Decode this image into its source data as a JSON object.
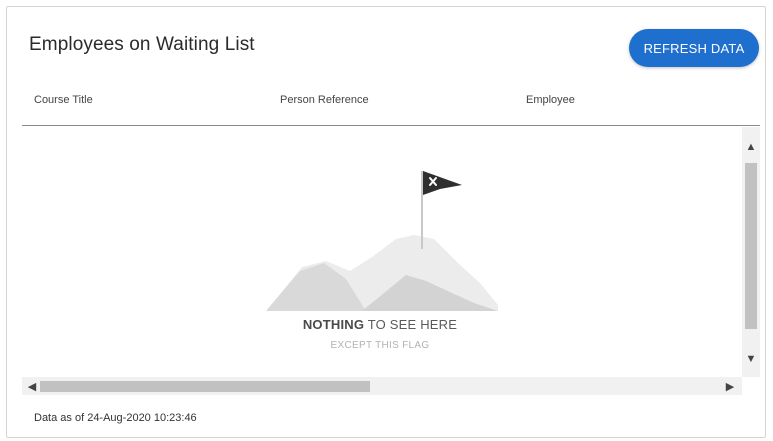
{
  "panel": {
    "title": "Employees on Waiting List",
    "refresh_label": "REFRESH DATA"
  },
  "table": {
    "columns": [
      "Course Title",
      "Person Reference",
      "Employee"
    ]
  },
  "empty_state": {
    "title_bold": "NOTHING",
    "title_rest": " TO SEE HERE",
    "subtitle": "EXCEPT THIS FLAG",
    "icon": "flag-on-mountain-icon"
  },
  "footer": {
    "timestamp_text": "Data as of 24-Aug-2020 10:23:46"
  },
  "colors": {
    "accent": "#1e6fce",
    "header_rule": "#8a8a8a",
    "mountain_light": "#ececec",
    "mountain_dark": "#d6d6d6"
  }
}
